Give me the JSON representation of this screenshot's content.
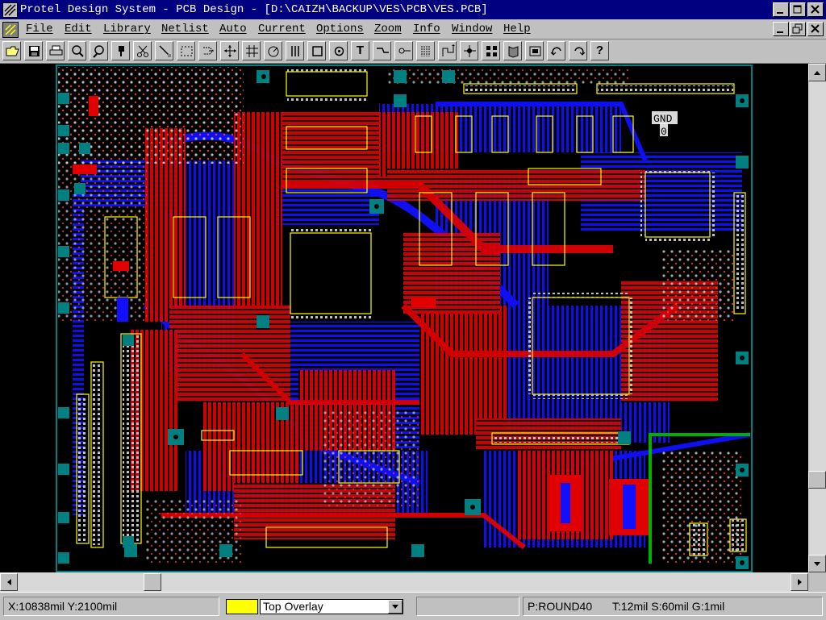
{
  "window": {
    "title": "Protel Design System - PCB Design - [D:\\CAIZH\\BACKUP\\VES\\PCB\\VES.PCB]"
  },
  "menu": [
    {
      "label": "File"
    },
    {
      "label": "Edit"
    },
    {
      "label": "Library"
    },
    {
      "label": "Netlist"
    },
    {
      "label": "Auto"
    },
    {
      "label": "Current"
    },
    {
      "label": "Options"
    },
    {
      "label": "Zoom"
    },
    {
      "label": "Info"
    },
    {
      "label": "Window"
    },
    {
      "label": "Help"
    }
  ],
  "toolbar": {
    "text_tool_label": "T",
    "help_label": "?",
    "icons": [
      "open-icon",
      "save-icon",
      "print-icon",
      "zoom-in-icon",
      "zoom-out-icon",
      "place-pad-icon",
      "cut-icon",
      "wire-icon",
      "select-area-icon",
      "move-icon",
      "cross-icon",
      "grid-icon",
      "arc-icon",
      "bus-icon",
      "component-icon",
      "via-icon",
      "text-icon",
      "track-icon",
      "pin-icon",
      "fanout-icon",
      "connect-icon",
      "route-icon",
      "pad-stack-icon",
      "library-icon",
      "report-icon",
      "undo-icon",
      "redo-icon",
      "help-icon"
    ]
  },
  "board": {
    "labels": {
      "gnd": "GND",
      "zero": "0"
    },
    "colors": {
      "background": "#000000",
      "top_layer": "#ff0000",
      "bottom_layer": "#0000ff",
      "overlay": "#ffff00",
      "keepout": "#00ff00",
      "pads": "#c0c0c0",
      "mech": "#008080"
    }
  },
  "status": {
    "coords": "X:10838mil Y:2100mil",
    "layer": "Top Overlay",
    "layer_color": "#ffff00",
    "pad_info": "P:ROUND40",
    "track_info": "T:12mil S:60mil  G:1mil"
  }
}
